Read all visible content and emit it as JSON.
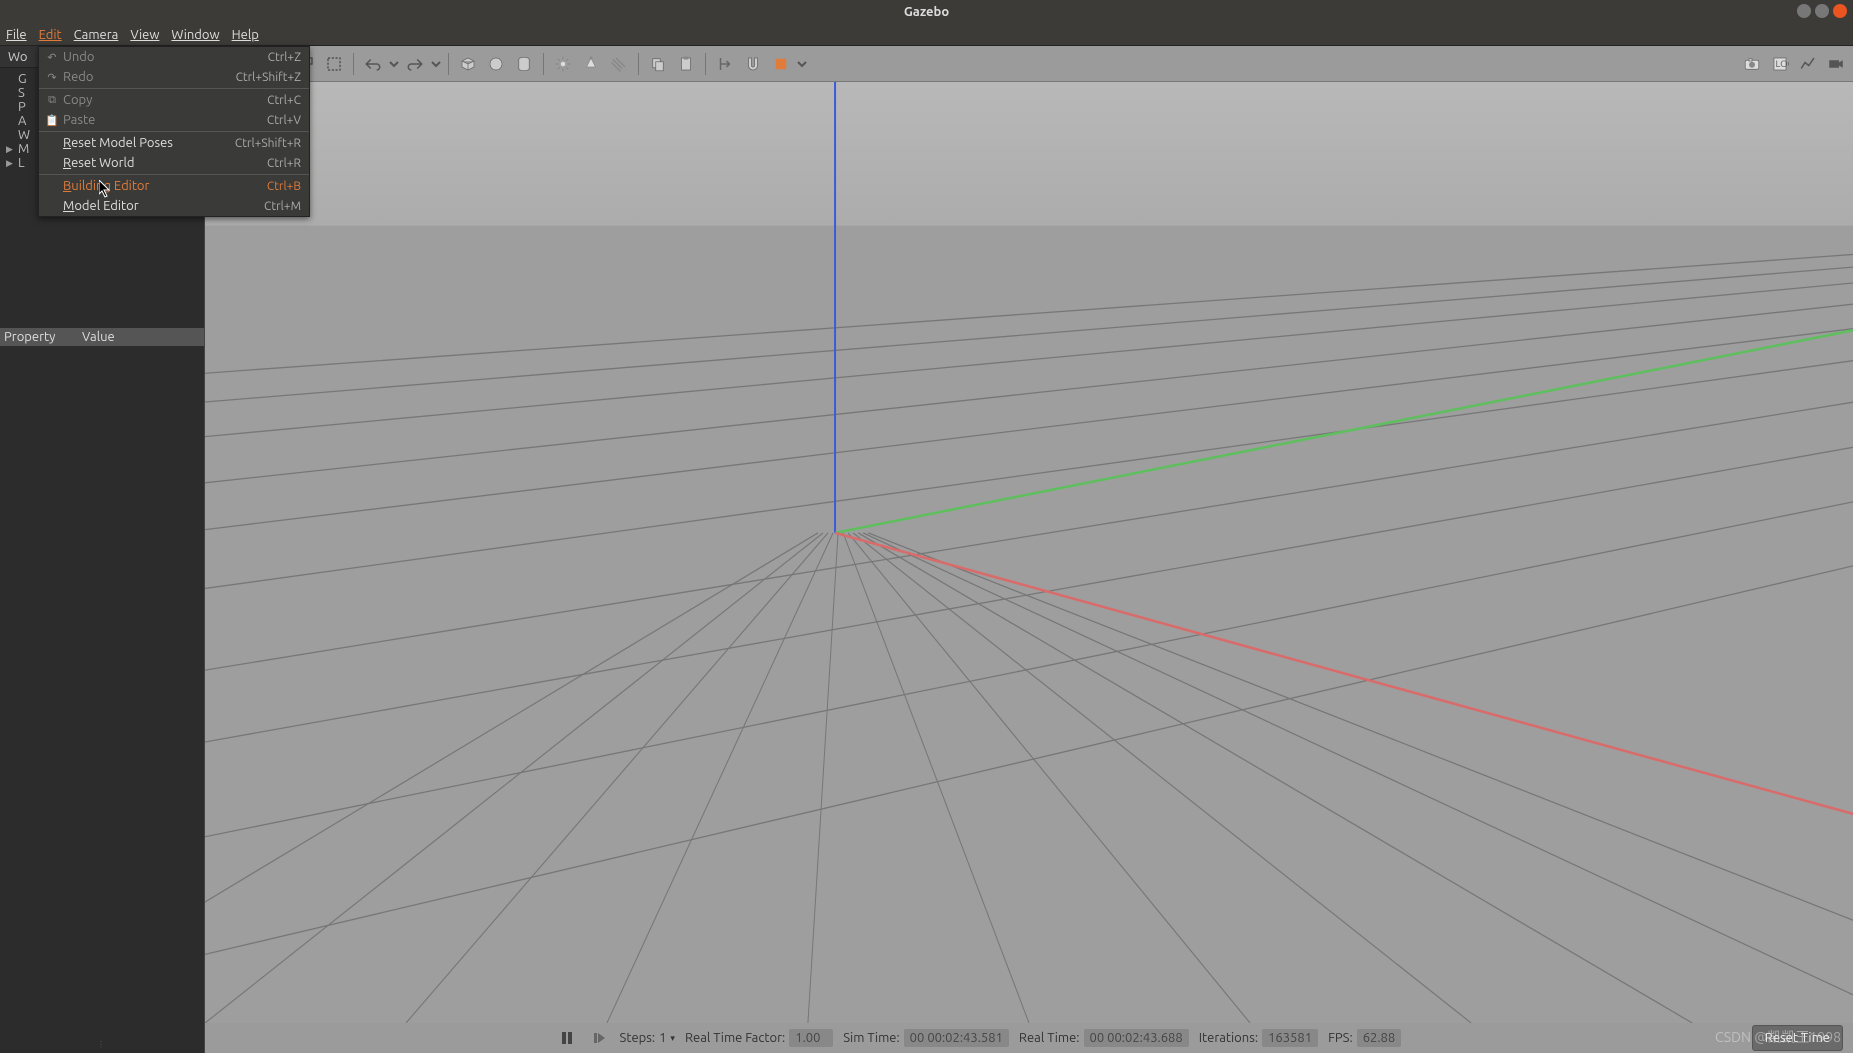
{
  "window": {
    "title": "Gazebo"
  },
  "menubar": {
    "items": [
      "File",
      "Edit",
      "Camera",
      "View",
      "Window",
      "Help"
    ],
    "active_index": 1
  },
  "edit_menu": {
    "undo": {
      "label": "Undo",
      "shortcut": "Ctrl+Z",
      "enabled": false
    },
    "redo": {
      "label": "Redo",
      "shortcut": "Ctrl+Shift+Z",
      "enabled": false
    },
    "copy": {
      "label": "Copy",
      "shortcut": "Ctrl+C",
      "enabled": false
    },
    "paste": {
      "label": "Paste",
      "shortcut": "Ctrl+V",
      "enabled": false
    },
    "reset_poses": {
      "label": "Reset Model Poses",
      "shortcut": "Ctrl+Shift+R"
    },
    "reset_world": {
      "label": "Reset World",
      "shortcut": "Ctrl+R"
    },
    "building_editor": {
      "label": "Building Editor",
      "shortcut": "Ctrl+B"
    },
    "model_editor": {
      "label": "Model Editor",
      "shortcut": "Ctrl+M"
    }
  },
  "left_panel": {
    "tab": "Wo",
    "tree": [
      "G",
      "S",
      "P",
      "A",
      "W",
      "M",
      "L"
    ],
    "property_header": "Property",
    "value_header": "Value"
  },
  "status": {
    "steps_label": "Steps:",
    "steps_value": "1",
    "rtf_label": "Real Time Factor:",
    "rtf_value": "1.00",
    "sim_label": "Sim Time:",
    "sim_value": "00 00:02:43.581",
    "real_label": "Real Time:",
    "real_value": "00 00:02:43.688",
    "iter_label": "Iterations:",
    "iter_value": "163581",
    "fps_label": "FPS:",
    "fps_value": "62.88",
    "reset_label": "Reset Time"
  },
  "watermark": "CSDN @凯凯王1998"
}
